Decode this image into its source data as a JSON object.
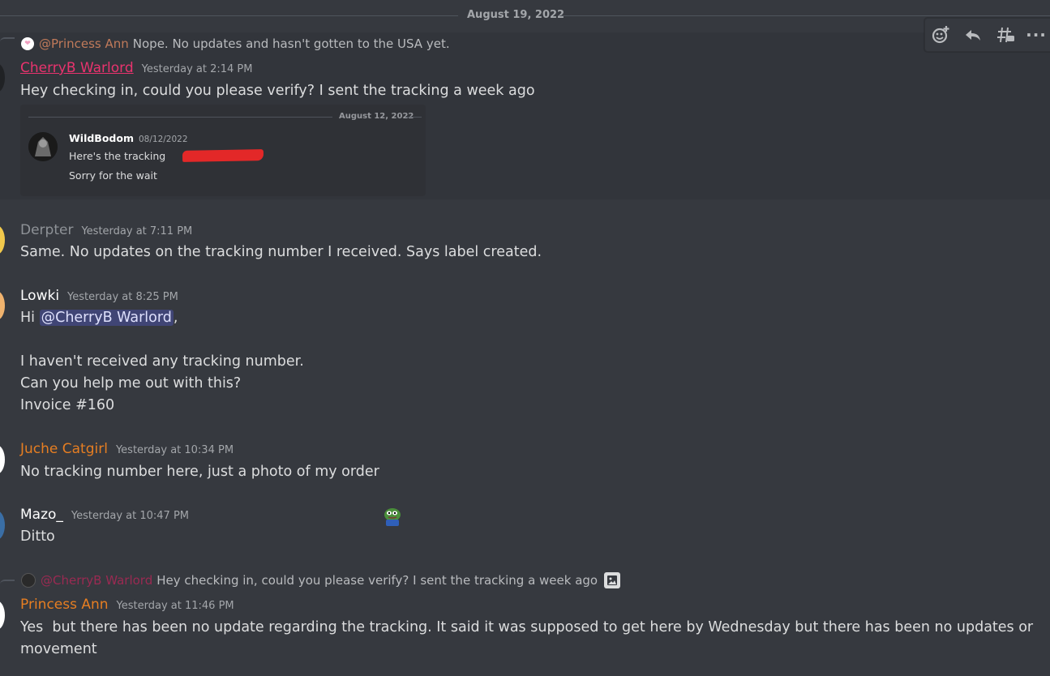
{
  "divider": {
    "date": "August 19, 2022"
  },
  "toolbar": {
    "icons": [
      "add-reaction-icon",
      "reply-icon",
      "create-thread-icon",
      "more-icon"
    ],
    "more_label": "···"
  },
  "messages": [
    {
      "reply": {
        "mention": "@Princess Ann",
        "text": "Nope. No updates and hasn't gotten to the USA yet."
      },
      "username": "CherryB Warlord",
      "timestamp": "Yesterday at 2:14 PM",
      "text": "Hey checking in, could you please verify? I sent the tracking a week ago",
      "embed": {
        "date": "August 12, 2022",
        "username": "WildBodom",
        "timestamp": "08/12/2022",
        "line1": "Here's the tracking",
        "line2": "Sorry for the wait"
      }
    },
    {
      "username": "Derpter",
      "timestamp": "Yesterday at 7:11 PM",
      "text": "Same. No updates on the tracking number I received. Says label created."
    },
    {
      "username": "Lowki",
      "timestamp": "Yesterday at 8:25 PM",
      "text_prefix": "Hi ",
      "mention": "@CherryB Warlord",
      "text_suffix": ",",
      "line2": "I haven't received any tracking number.",
      "line3": "Can you help me out with this?",
      "line4": "Invoice #160"
    },
    {
      "username": "Juche Catgirl",
      "timestamp": "Yesterday at 10:34 PM",
      "text": "No tracking number here, just a photo of my order"
    },
    {
      "username": "Mazo_",
      "timestamp": "Yesterday at 10:47 PM",
      "text": "Ditto"
    },
    {
      "reply": {
        "mention": "@CherryB Warlord",
        "text": "Hey checking in, could you please verify? I sent the tracking a week ago"
      },
      "username": "Princess Ann",
      "timestamp": "Yesterday at 11:46 PM",
      "line1": "Yes  but there has been no update regarding the tracking. It said it was supposed to get here by Wednesday but there has been no updates or",
      "line2": "movement"
    }
  ],
  "colors": {
    "background": "#36393f",
    "cherryb": "#e9336e",
    "derpter": "#8e9297",
    "white_user": "#ffffff",
    "orange_user": "#e67e22",
    "mention_bg": "#414675"
  }
}
